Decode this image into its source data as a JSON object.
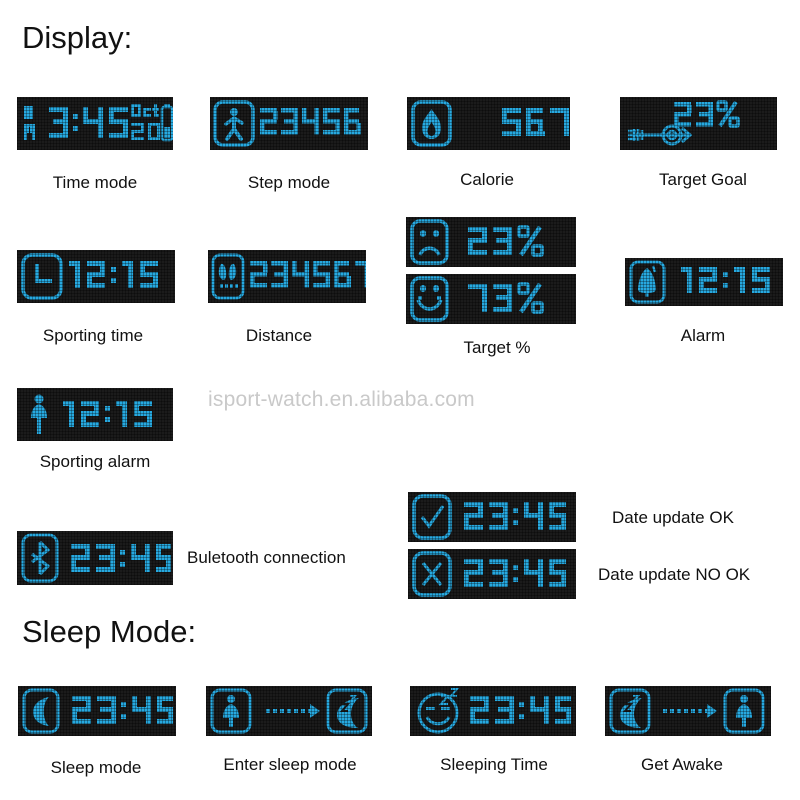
{
  "sections": [
    {
      "id": "display",
      "title": "Display:"
    },
    {
      "id": "sleep",
      "title": "Sleep Mode:"
    }
  ],
  "watermark": "isport-watch.en.alibaba.com",
  "colors": {
    "lcd_background": "#1b1b1b",
    "lcd_foreground": "#27a9e0",
    "page_background": "#ffffff",
    "text": "#111111",
    "watermark": "#c9c9c9"
  },
  "display_modes": [
    {
      "key": "time-mode",
      "caption": "Time mode",
      "icon": "battery-icon",
      "meridiem": "PM",
      "time": "3:45",
      "date_month": "Oct",
      "date_day": "20"
    },
    {
      "key": "step-mode",
      "caption": "Step mode",
      "icon": "walking-person-icon",
      "value": "234567"
    },
    {
      "key": "calorie",
      "caption": "Calorie",
      "icon": "flame-icon",
      "value": "567"
    },
    {
      "key": "target-goal",
      "caption": "Target Goal",
      "icon": "dart-target-icon",
      "value": "23%"
    },
    {
      "key": "sporting-time",
      "caption": "Sporting time",
      "icon": "clock-icon",
      "value": "12:15"
    },
    {
      "key": "distance",
      "caption": "Distance",
      "icon": "footprints-icon",
      "value": "234567"
    },
    {
      "key": "target-percent",
      "caption": "Target %",
      "rows": [
        {
          "icon": "sad-face-icon",
          "value": "23%"
        },
        {
          "icon": "happy-face-icon",
          "value": "73%"
        }
      ]
    },
    {
      "key": "alarm",
      "caption": "Alarm",
      "icon": "bell-icon",
      "value": "12:15"
    },
    {
      "key": "sporting-alarm",
      "caption": "Sporting alarm",
      "icon": "standing-person-icon",
      "value": "12:15"
    },
    {
      "key": "bluetooth",
      "caption": "Buletooth connection",
      "icon": "bluetooth-icon",
      "value": "23:45"
    },
    {
      "key": "date-update-ok",
      "caption": "Date update OK",
      "icon": "check-icon",
      "value": "23:45"
    },
    {
      "key": "date-update-no-ok",
      "caption": "Date update NO OK",
      "icon": "cross-icon",
      "value": "23:45"
    }
  ],
  "sleep_modes": [
    {
      "key": "sleep-mode",
      "caption": "Sleep mode",
      "icon": "moon-icon",
      "value": "23:45"
    },
    {
      "key": "enter-sleep-mode",
      "caption": "Enter sleep mode",
      "icon_from": "standing-person-icon",
      "icon_arrow": "dashed-arrow-right-icon",
      "icon_to": "sleeping-moon-icon"
    },
    {
      "key": "sleeping-time",
      "caption": "Sleeping Time",
      "icon": "sleeping-face-icon",
      "value": "23:45"
    },
    {
      "key": "get-awake",
      "caption": "Get Awake",
      "icon_from": "sleeping-moon-icon",
      "icon_arrow": "dashed-arrow-right-icon",
      "icon_to": "standing-person-icon"
    }
  ]
}
